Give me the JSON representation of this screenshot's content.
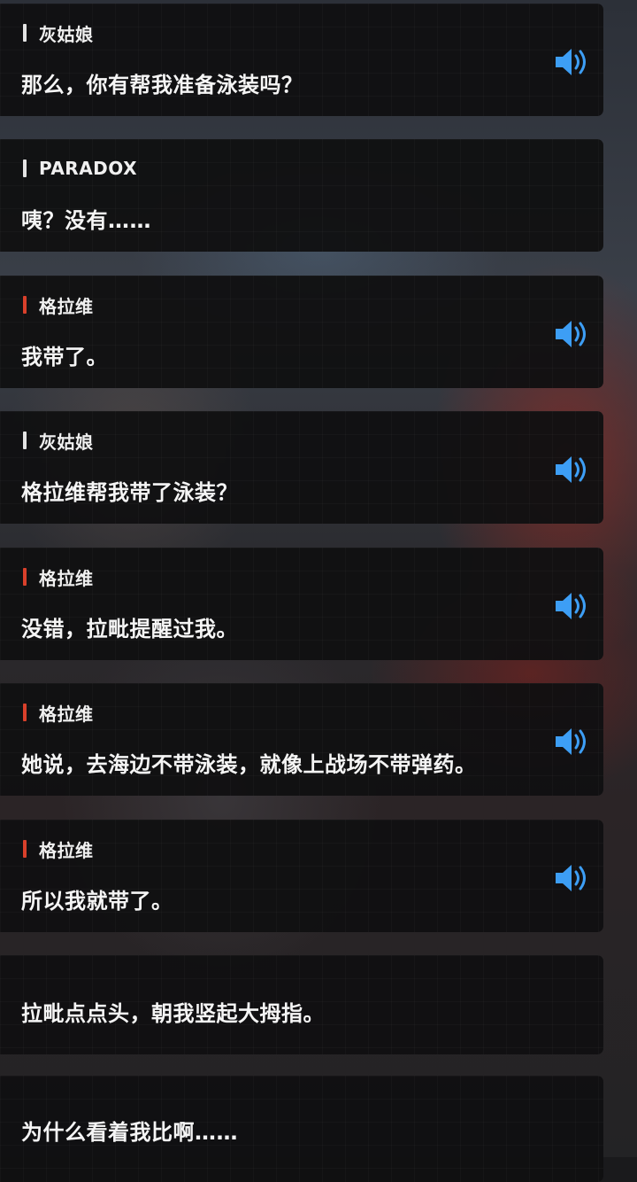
{
  "colors": {
    "bar_neutral": "#e4e4e4",
    "bar_accent": "#d9402b",
    "voice_icon": "#3d9ef5"
  },
  "dialogue": [
    {
      "speaker": "灰姑娘",
      "bar": "neutral",
      "text": "那么，你有帮我准备泳装吗？",
      "voice": true
    },
    {
      "speaker": "PARADOX",
      "bar": "neutral",
      "text": "咦？没有……",
      "voice": false
    },
    {
      "speaker": "格拉维",
      "bar": "accent",
      "text": "我带了。",
      "voice": true
    },
    {
      "speaker": "灰姑娘",
      "bar": "neutral",
      "text": "格拉维帮我带了泳装？",
      "voice": true
    },
    {
      "speaker": "格拉维",
      "bar": "accent",
      "text": "没错，拉毗提醒过我。",
      "voice": true
    },
    {
      "speaker": "格拉维",
      "bar": "accent",
      "text": "她说，去海边不带泳装，就像上战场不带弹药。",
      "voice": true
    },
    {
      "speaker": "格拉维",
      "bar": "accent",
      "text": "所以我就带了。",
      "voice": true
    }
  ],
  "narration": [
    {
      "text": "拉毗点点头，朝我竖起大拇指。"
    },
    {
      "text": "为什么看着我比啊……"
    }
  ]
}
